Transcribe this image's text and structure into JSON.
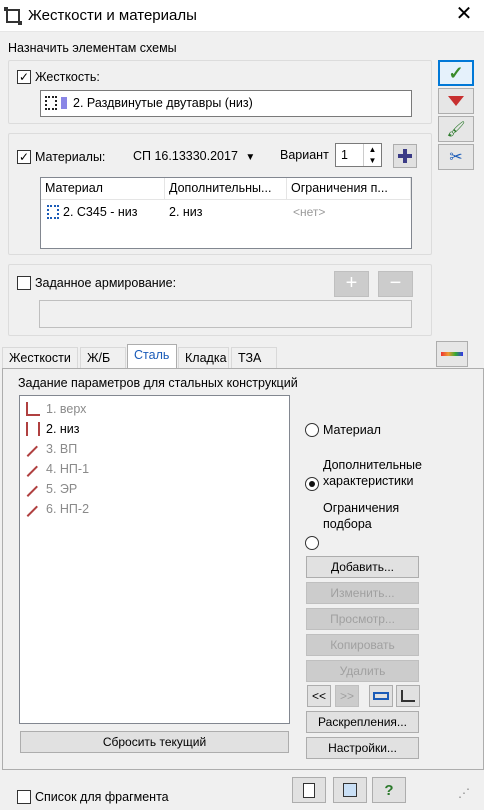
{
  "window": {
    "title": "Жесткости и материалы",
    "close_glyph": "✕",
    "icon": "app-grid-icon"
  },
  "assign_label": "Назначить элементам схемы",
  "stiffness": {
    "label": "Жесткость:",
    "checked": true,
    "value": "2. Раздвинутые двутавры (низ)"
  },
  "materials": {
    "label": "Материалы:",
    "checked": true,
    "norm": "СП 16.13330.2017",
    "variant_label": "Вариант",
    "variant_value": "1",
    "columns": [
      "Материал",
      "Дополнительны...",
      "Ограничения п..."
    ],
    "rows": [
      {
        "material": "2. С345 - низ",
        "additional": "2. низ",
        "limits": "<нет>"
      }
    ]
  },
  "reinforcement": {
    "label": "Заданное армирование:",
    "checked": false
  },
  "tabs": [
    {
      "label": "Жесткости",
      "active": false
    },
    {
      "label": "Ж/Б",
      "active": false
    },
    {
      "label": "Сталь",
      "active": true
    },
    {
      "label": "Кладка",
      "active": false
    },
    {
      "label": "ТЗА",
      "active": false
    }
  ],
  "steel": {
    "heading": "Задание параметров для стальных конструкций",
    "items": [
      {
        "label": "1. верх",
        "enabled": false,
        "icon": "beam-icon"
      },
      {
        "label": "2. низ",
        "enabled": true,
        "icon": "double-beam-icon"
      },
      {
        "label": "3. ВП",
        "enabled": false,
        "icon": "rod-icon"
      },
      {
        "label": "4. НП-1",
        "enabled": false,
        "icon": "rod-icon"
      },
      {
        "label": "5. ЭР",
        "enabled": false,
        "icon": "rod-icon"
      },
      {
        "label": "6. НП-2",
        "enabled": false,
        "icon": "rod-icon"
      }
    ],
    "radios": [
      {
        "label": "Материал",
        "checked": false
      },
      {
        "label": "Дополнительные характеристики",
        "checked": true
      },
      {
        "label": "Ограничения подбора",
        "checked": false
      }
    ],
    "buttons": {
      "add": "Добавить...",
      "edit": "Изменить...",
      "view": "Просмотр...",
      "copy": "Копировать",
      "delete": "Удалить",
      "prev": "<<",
      "next": ">>",
      "fix": "Раскрепления...",
      "settings": "Настройки...",
      "reset": "Сбросить текущий"
    }
  },
  "footer": {
    "fragment_label": "Список для фрагмента",
    "fragment_checked": false
  },
  "side_tools": [
    "apply-check-icon",
    "filter-icon",
    "brush-icon",
    "scissors-icon"
  ],
  "colors": {
    "accent": "#0078d7",
    "disabled_text": "#8a8a8a",
    "active_tab": "#1a5bb8"
  }
}
